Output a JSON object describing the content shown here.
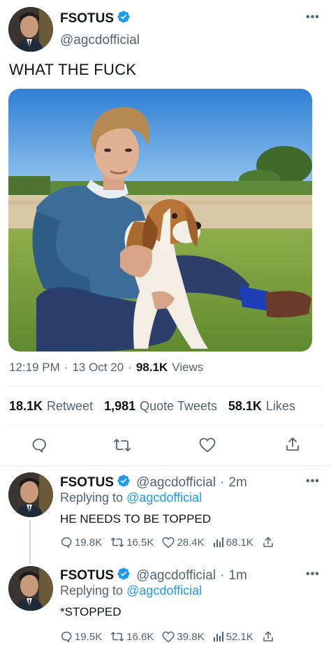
{
  "main_tweet": {
    "display_name": "FSOTUS",
    "handle": "@agcdofficial",
    "text": "WHAT THE FUCK",
    "time": "12:19 PM",
    "date": "13 Oct 20",
    "views_count": "98.1K",
    "views_label": "Views",
    "retweets_count": "18.1K",
    "retweets_label": "Retweet",
    "quotes_count": "1,981",
    "quotes_label": "Quote Tweets",
    "likes_count": "58.1K",
    "likes_label": "Likes",
    "more_icon": "more-horizontal-icon"
  },
  "replies": [
    {
      "display_name": "FSOTUS",
      "handle": "@agcdofficial",
      "time_ago": "2m",
      "replying_prefix": "Replying to",
      "replying_to": "@agcdofficial",
      "text": "HE NEEDS TO BE TOPPED",
      "reply_count": "19.8K",
      "retweet_count": "16.5K",
      "like_count": "28.4K",
      "view_count": "68.1K"
    },
    {
      "display_name": "FSOTUS",
      "handle": "@agcdofficial",
      "time_ago": "1m",
      "replying_prefix": "Replying to",
      "replying_to": "@agcdofficial",
      "text": "*STOPPED",
      "reply_count": "19.5K",
      "retweet_count": "16.6K",
      "like_count": "39.8K",
      "view_count": "52.1K"
    }
  ],
  "colors": {
    "accent": "#1d9bf0",
    "secondary_text": "#536471",
    "primary_text": "#0f1419"
  }
}
